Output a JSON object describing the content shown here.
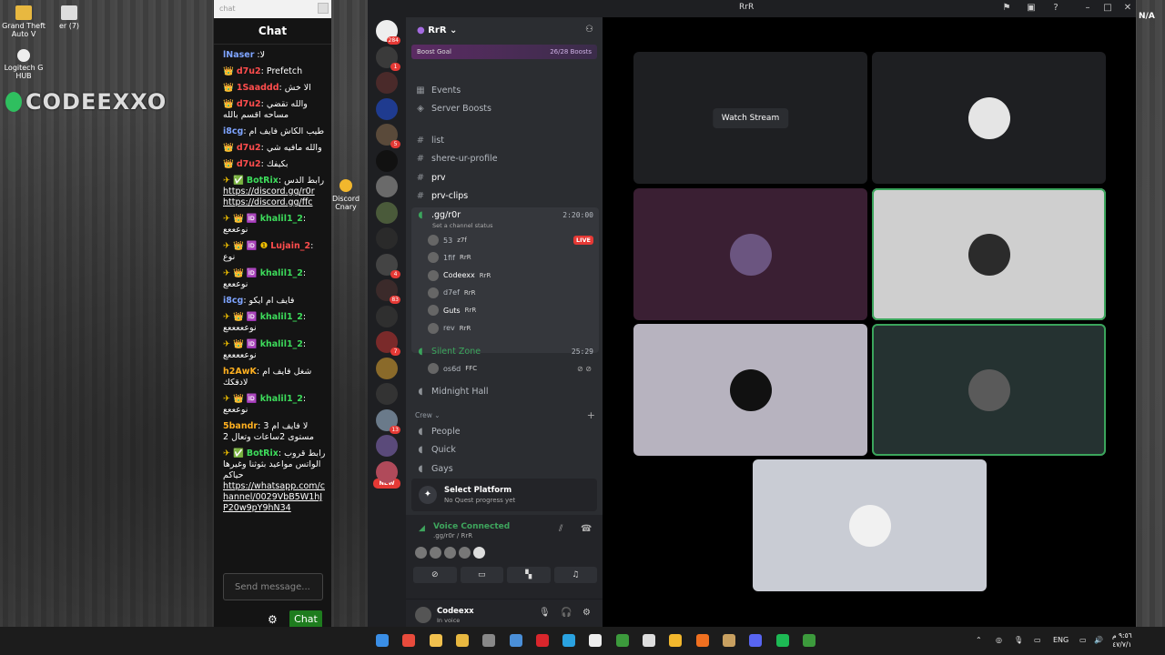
{
  "desktop": {
    "icons": [
      {
        "label": "Grand Theft Auto V",
        "color": "#e8b840"
      },
      {
        "label": "er (7)",
        "color": "#ddd"
      },
      {
        "label": "Logitech G HUB",
        "color": "#eee"
      }
    ],
    "watermark": "CODEEXXO",
    "discord_shortcut": "Discord Cnary"
  },
  "chat": {
    "top_placeholder": "chat",
    "title": "Chat",
    "input_placeholder": "Send message...",
    "send_label": "Chat",
    "messages": [
      {
        "prefix": "",
        "user": "lNaser",
        "color": "#7ea4ff",
        "text": " :لا",
        "links": []
      },
      {
        "prefix": "👑 ",
        "user": "d7u2",
        "color": "#ff4d4d",
        "text": ": Prefetch",
        "links": []
      },
      {
        "prefix": "👑 ",
        "user": "1Saaddd",
        "color": "#ff4d4d",
        "text": ": الا خش",
        "links": []
      },
      {
        "prefix": "👑 ",
        "user": "d7u2",
        "color": "#ff4d4d",
        "text": ": والله تقضي مساحه اقسم بالله",
        "links": []
      },
      {
        "prefix": "",
        "user": "i8cg",
        "color": "#7ea4ff",
        "text": ": طيب الكاش فايف ام",
        "links": []
      },
      {
        "prefix": "👑 ",
        "user": "d7u2",
        "color": "#ff4d4d",
        "text": ": والله مافيه شي",
        "links": []
      },
      {
        "prefix": "👑 ",
        "user": "d7u2",
        "color": "#ff4d4d",
        "text": ": بكيفك",
        "links": []
      },
      {
        "prefix": "✈ ✅ ",
        "user": "BotRix",
        "color": "#3ddc5b",
        "text": ": رابط الدس ",
        "links": [
          "https://discord.gg/r0r",
          "https://discord.gg/ffc"
        ]
      },
      {
        "prefix": "✈ 👑 🆔 ",
        "user": "khalil1_2",
        "color": "#3ddc5b",
        "text": ": نوعععع",
        "links": []
      },
      {
        "prefix": "✈ 👑 🆔 ❶ ",
        "user": "Lujain_2",
        "color": "#ff4d4d",
        "text": ": نوع",
        "links": []
      },
      {
        "prefix": "✈ 👑 🆔 ",
        "user": "khalil1_2",
        "color": "#3ddc5b",
        "text": ": نوعععع",
        "links": []
      },
      {
        "prefix": "",
        "user": "i8cg",
        "color": "#7ea4ff",
        "text": ": فايف ام ايكو",
        "links": []
      },
      {
        "prefix": "✈ 👑 🆔 ",
        "user": "khalil1_2",
        "color": "#3ddc5b",
        "text": ": نوعععععع",
        "links": []
      },
      {
        "prefix": "✈ 👑 🆔 ",
        "user": "khalil1_2",
        "color": "#3ddc5b",
        "text": ": نوعععععع",
        "links": []
      },
      {
        "prefix": "",
        "user": "h2AwK",
        "color": "#ffb020",
        "text": ": شغل فايف ام لادقكك",
        "links": []
      },
      {
        "prefix": "✈ 👑 🆔 ",
        "user": "khalil1_2",
        "color": "#3ddc5b",
        "text": ": نوعععع",
        "links": []
      },
      {
        "prefix": "",
        "user": "5bandr",
        "color": "#ffb020",
        "text": ": لا فايف ام 3 مستوى 2ساعات وتعال 2",
        "links": []
      },
      {
        "prefix": "✈ ✅ ",
        "user": "BotRix",
        "color": "#3ddc5b",
        "text": ": رابط قروب الواتس مواعيد بثوثنا وغيرها حياكم ",
        "links": [
          "https://whatsapp.com/channel/0029VbB5W1hJP20w9pY9hN34"
        ]
      }
    ]
  },
  "discord": {
    "window_title": "RrR",
    "na": "N/A",
    "server_name": "RrR",
    "boost": {
      "label": "Boost Goal",
      "progress": "26/28 Boosts"
    },
    "nav": [
      "Events",
      "Server Boosts"
    ],
    "text_channels": [
      "list",
      "shere-ur-profile",
      "prv",
      "prv-clips"
    ],
    "voice_channel": {
      "name": ".gg/r0r",
      "status": "Set a channel status",
      "time": "2:20:00"
    },
    "voice_users": [
      {
        "name": "53",
        "tag": "z7f",
        "live": "LIVE"
      },
      {
        "name": "1fif",
        "tag": "RrR",
        "live": ""
      },
      {
        "name": "Codeexx",
        "tag": "RrR",
        "live": ""
      },
      {
        "name": "d7ef",
        "tag": "RrR",
        "live": ""
      },
      {
        "name": "Guts",
        "tag": "RrR",
        "live": ""
      },
      {
        "name": "rev",
        "tag": "RrR",
        "live": ""
      }
    ],
    "silent_zone": {
      "name": "Silent Zone",
      "time": "25:29",
      "user": "os6d",
      "tag": "FFC"
    },
    "midnight": "Midnight Hall",
    "category": "Crew",
    "crew_channels": [
      "People",
      "Quick",
      "Gays"
    ],
    "quest": {
      "title": "Select Platform",
      "sub": "No Quest progress yet"
    },
    "voice_connected": {
      "label": "Voice Connected",
      "sub": ".gg/r0r / RrR"
    },
    "user": {
      "name": "Codeexx",
      "status": "In voice"
    },
    "server_badges": [
      "284",
      "1",
      "",
      "",
      "5",
      "",
      "",
      "",
      "",
      "4",
      "83",
      "",
      "7",
      "",
      "",
      "13",
      "",
      ""
    ],
    "new_badge": "NEW",
    "watch_stream": "Watch Stream",
    "tile_colors": [
      "#1e1f22",
      "#1e1f22",
      "#3a1f33",
      "#cfcfcf",
      "#b7b3bf",
      "#253231",
      "#c9ccd4"
    ]
  },
  "taskbar": {
    "lang": "ENG",
    "clock_line1": "٩:٥٦ م",
    "clock_line2": "٤٧/٧/١"
  }
}
